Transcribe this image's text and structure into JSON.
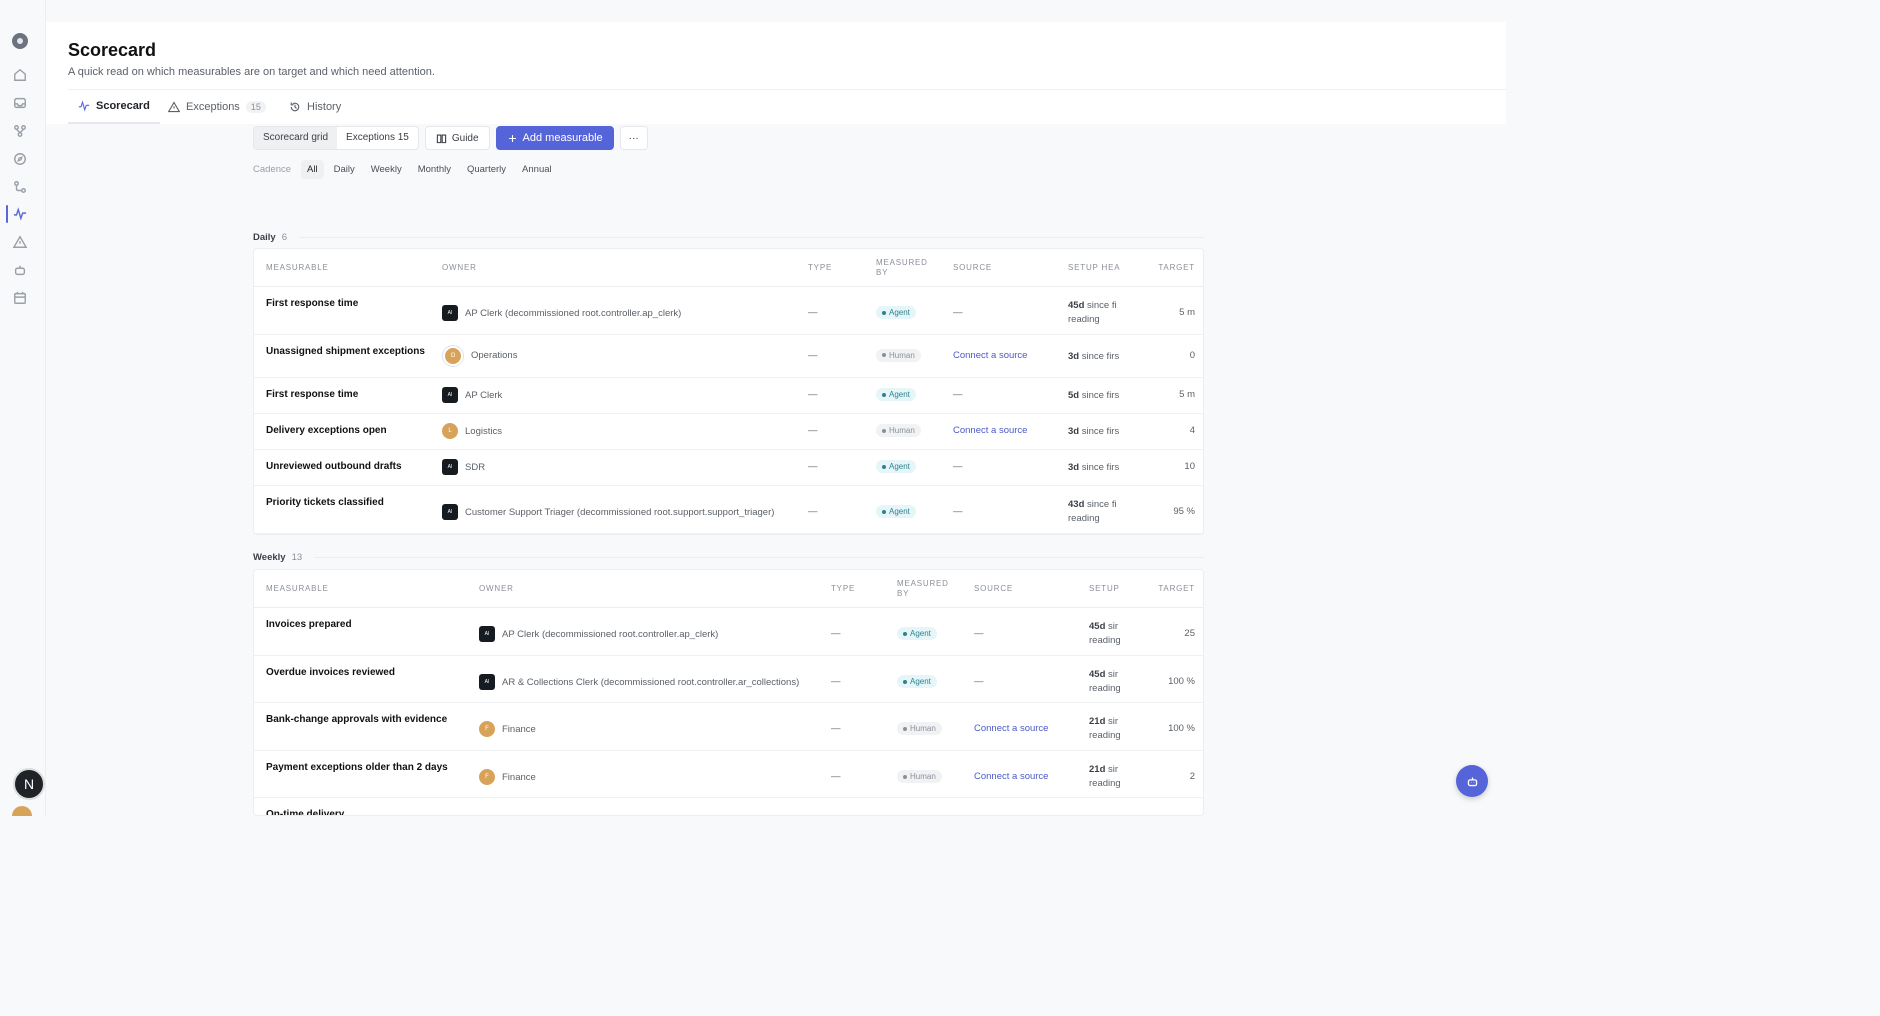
{
  "sidebar": {
    "icons": [
      "logo-icon",
      "home-icon",
      "inbox-icon",
      "workflow-icon",
      "compass-icon",
      "route-icon",
      "pulse-icon",
      "alert-icon",
      "bot-icon",
      "calendar-icon"
    ],
    "user_initial": "N"
  },
  "header": {
    "title": "Scorecard",
    "subtitle": "A quick read on which measurables are on target and which need attention."
  },
  "tabs": [
    {
      "label": "Scorecard",
      "icon": "pulse-icon"
    },
    {
      "label": "Exceptions",
      "icon": "alert-icon",
      "count": "15"
    },
    {
      "label": "History",
      "icon": "history-icon"
    }
  ],
  "toolbar": {
    "view_grid": "Scorecard grid",
    "view_exceptions": "Exceptions 15",
    "guide": "Guide",
    "add": "Add measurable",
    "more": "···"
  },
  "cadence": {
    "label": "Cadence",
    "options": [
      "All",
      "Daily",
      "Weekly",
      "Monthly",
      "Quarterly",
      "Annual"
    ],
    "selected": "All"
  },
  "daily": {
    "label": "Daily",
    "count": "6",
    "headers": {
      "measurable": "MEASURABLE",
      "owner": "OWNER",
      "type": "TYPE",
      "measured_by": "MEASURED BY",
      "source": "SOURCE",
      "setup": "SETUP HEA",
      "target": "TARGET"
    },
    "rows": [
      {
        "measurable": "First response time",
        "owner": "AP Clerk (decommissioned root.controller.ap_clerk)",
        "avatar": "AI",
        "type": "—",
        "measured_by": "Agent",
        "source": "—",
        "setup_bold": "45d",
        "setup_1": "since fi",
        "setup_2": "reading",
        "target": "5 m"
      },
      {
        "measurable": "Unassigned shipment exceptions",
        "owner": "Operations",
        "avatar": "O",
        "type": "—",
        "measured_by": "Human",
        "source": "Connect a source",
        "setup_bold": "3d",
        "setup_1": "since firs",
        "setup_2": "",
        "target": "0"
      },
      {
        "measurable": "First response time",
        "owner": "AP Clerk",
        "avatar": "AI",
        "type": "—",
        "measured_by": "Agent",
        "source": "—",
        "setup_bold": "5d",
        "setup_1": "since firs",
        "setup_2": "",
        "target": "5 m"
      },
      {
        "measurable": "Delivery exceptions open",
        "owner": "Logistics",
        "avatar": "L",
        "type": "—",
        "measured_by": "Human",
        "source": "Connect a source",
        "setup_bold": "3d",
        "setup_1": "since firs",
        "setup_2": "",
        "target": "4"
      },
      {
        "measurable": "Unreviewed outbound drafts",
        "owner": "SDR",
        "avatar": "AI",
        "type": "—",
        "measured_by": "Agent",
        "source": "—",
        "setup_bold": "3d",
        "setup_1": "since firs",
        "setup_2": "",
        "target": "10"
      },
      {
        "measurable": "Priority tickets classified",
        "owner": "Customer Support Triager (decommissioned root.support.support_triager)",
        "avatar": "AI",
        "type": "—",
        "measured_by": "Agent",
        "source": "—",
        "setup_bold": "43d",
        "setup_1": "since fi",
        "setup_2": "reading",
        "target": "95 %"
      }
    ]
  },
  "weekly": {
    "label": "Weekly",
    "count": "13",
    "headers": {
      "measurable": "MEASURABLE",
      "owner": "OWNER",
      "type": "TYPE",
      "measured_by": "MEASURED BY",
      "source": "SOURCE",
      "setup": "SETUP",
      "target": "TARGET"
    },
    "rows": [
      {
        "measurable": "Invoices prepared",
        "owner": "AP Clerk (decommissioned root.controller.ap_clerk)",
        "avatar": "AI",
        "type": "—",
        "measured_by": "Agent",
        "source": "—",
        "setup_bold": "45d",
        "setup_1": "sir",
        "setup_2": "reading",
        "target": "25"
      },
      {
        "measurable": "Overdue invoices reviewed",
        "owner": "AR & Collections Clerk (decommissioned root.controller.ar_collections)",
        "avatar": "AI",
        "type": "—",
        "measured_by": "Agent",
        "source": "—",
        "setup_bold": "45d",
        "setup_1": "sir",
        "setup_2": "reading",
        "target": "100 %"
      },
      {
        "measurable": "Bank-change approvals with evidence",
        "owner": "Finance",
        "avatar": "F",
        "type": "—",
        "measured_by": "Human",
        "source": "Connect a source",
        "setup_bold": "21d",
        "setup_1": "sir",
        "setup_2": "reading",
        "target": "100 %"
      },
      {
        "measurable": "Payment exceptions older than 2 days",
        "owner": "Finance",
        "avatar": "F",
        "type": "—",
        "measured_by": "Human",
        "source": "Connect a source",
        "setup_bold": "21d",
        "setup_1": "sir",
        "setup_2": "reading",
        "target": "2"
      },
      {
        "measurable": "On-time delivery",
        "owner": "",
        "avatar": "",
        "type": "",
        "measured_by": "",
        "source": "",
        "setup_bold": "",
        "setup_1": "",
        "setup_2": "",
        "target": ""
      }
    ]
  },
  "colors": {
    "accent": "#5664d9",
    "agent_pill": "#e6f6f8",
    "human_pill": "#f1f2f4",
    "human_avatar": "#d7a35b"
  }
}
